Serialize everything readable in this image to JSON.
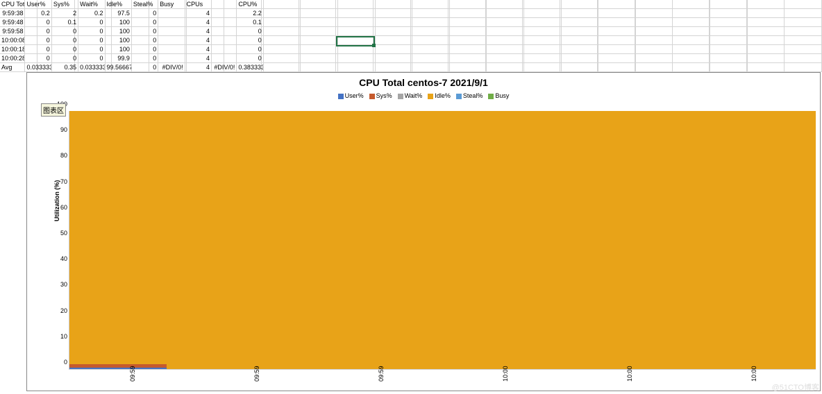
{
  "watermark": "@51CTO博客",
  "tooltip": "图表区",
  "table": {
    "headers": [
      "CPU Total",
      "User%",
      "Sys%",
      "Wait%",
      "Idle%",
      "Steal%",
      "Busy",
      "CPUs",
      "",
      "CPU%"
    ],
    "rows": [
      [
        "9:59:38",
        "0.2",
        "2",
        "0.2",
        "97.5",
        "0",
        "",
        "4",
        "",
        "2.2"
      ],
      [
        "9:59:48",
        "0",
        "0.1",
        "0",
        "100",
        "0",
        "",
        "4",
        "",
        "0.1"
      ],
      [
        "9:59:58",
        "0",
        "0",
        "0",
        "100",
        "0",
        "",
        "4",
        "",
        "0"
      ],
      [
        "10:00:08",
        "0",
        "0",
        "0",
        "100",
        "0",
        "",
        "4",
        "",
        "0"
      ],
      [
        "10:00:18",
        "0",
        "0",
        "0",
        "100",
        "0",
        "",
        "4",
        "",
        "0"
      ],
      [
        "10:00:28",
        "0",
        "0",
        "0",
        "99.9",
        "0",
        "",
        "4",
        "",
        "0"
      ]
    ],
    "avg_label": "Avg",
    "avg": [
      "",
      "0.033333",
      "0.35",
      "0.033333",
      "99.56667",
      "0",
      "#DIV/0!",
      "4",
      "#DIV/0!",
      "0.383333"
    ]
  },
  "chart_data": {
    "type": "area",
    "title": "CPU Total centos-7  2021/9/1",
    "ylabel": "Utilization (%)",
    "ylim": [
      0,
      100
    ],
    "y_ticks": [
      0,
      10,
      20,
      30,
      40,
      50,
      60,
      70,
      80,
      90,
      100
    ],
    "x_ticks": [
      "09:59",
      "09:59",
      "09:59",
      "10:00",
      "10:00",
      "10:00"
    ],
    "legend": [
      {
        "name": "User%",
        "color": "#4472c4"
      },
      {
        "name": "Sys%",
        "color": "#c55a2d"
      },
      {
        "name": "Wait%",
        "color": "#a5a5a5"
      },
      {
        "name": "Idle%",
        "color": "#e8a318"
      },
      {
        "name": "Steal%",
        "color": "#5b9bd5"
      },
      {
        "name": "Busy",
        "color": "#70ad47"
      }
    ],
    "categories": [
      "9:59:38",
      "9:59:48",
      "9:59:58",
      "10:00:08",
      "10:00:18",
      "10:00:28"
    ],
    "series": [
      {
        "name": "User%",
        "values": [
          0.2,
          0,
          0,
          0,
          0,
          0
        ]
      },
      {
        "name": "Sys%",
        "values": [
          2,
          0.1,
          0,
          0,
          0,
          0
        ]
      },
      {
        "name": "Wait%",
        "values": [
          0.2,
          0,
          0,
          0,
          0,
          0
        ]
      },
      {
        "name": "Idle%",
        "values": [
          97.5,
          100,
          100,
          100,
          100,
          99.9
        ]
      },
      {
        "name": "Steal%",
        "values": [
          0,
          0,
          0,
          0,
          0,
          0
        ]
      },
      {
        "name": "Busy",
        "values": [
          0,
          0,
          0,
          0,
          0,
          0
        ]
      }
    ]
  }
}
